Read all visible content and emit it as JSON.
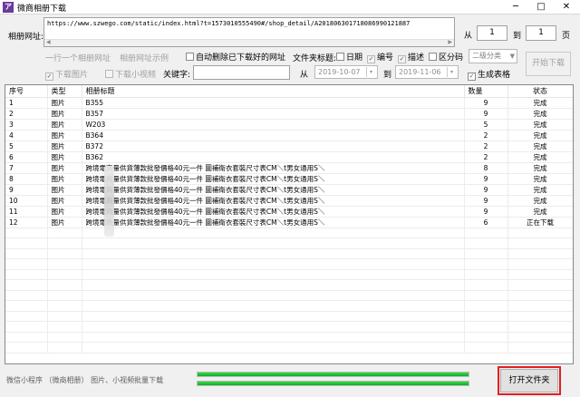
{
  "window": {
    "title": "微商相册下载",
    "icon_letter": "ア",
    "min": "─",
    "max": "□",
    "close": "✕"
  },
  "form": {
    "url_label": "相册网址:",
    "url_value": "https://www.szwego.com/static/index.html?t=1573010555490#/shop_detail/A201806301718086990121887",
    "from_label": "从",
    "from_value": "1",
    "to_label": "到",
    "to_value": "1",
    "page_label": "页",
    "one_per_line": "一行一个相册网址",
    "url_example": "相册网址示例",
    "auto_delete": "自动删除已下载好的网址",
    "folder_title_label": "文件夹标题:",
    "opt_date": "日期",
    "opt_number": "编号",
    "opt_desc": "描述",
    "opt_split": "区分码",
    "category_combo": "二级分类",
    "start_button": "开始下载",
    "download_images": "下载图片",
    "download_videos": "下载小视频",
    "keyword_label": "关键字:",
    "date_from_label": "从",
    "date_from": "2019-10-07",
    "date_to_label": "到",
    "date_to": "2019-11-06",
    "generate_table": "生成表格"
  },
  "table": {
    "columns": [
      "序号",
      "类型",
      "相册标题",
      "数量",
      "状态"
    ],
    "rows": [
      {
        "no": "1",
        "type": "图片",
        "title": "B355",
        "count": "9",
        "status": "完成"
      },
      {
        "no": "2",
        "type": "图片",
        "title": "B357",
        "count": "9",
        "status": "完成"
      },
      {
        "no": "3",
        "type": "图片",
        "title": "W203",
        "count": "5",
        "status": "完成"
      },
      {
        "no": "4",
        "type": "图片",
        "title": "B364",
        "count": "2",
        "status": "完成"
      },
      {
        "no": "5",
        "type": "图片",
        "title": "B372",
        "count": "2",
        "status": "完成"
      },
      {
        "no": "6",
        "type": "图片",
        "title": "B362",
        "count": "2",
        "status": "完成"
      },
      {
        "no": "7",
        "type": "图片",
        "title": "跨境電商量供貨薄款批發價格40元一件 圖補衛衣套裝尺寸表CM＼t男女通用S＼",
        "count": "8",
        "status": "完成"
      },
      {
        "no": "8",
        "type": "图片",
        "title": "跨境電商量供貨薄款批發價格40元一件 圖補衛衣套裝尺寸表CM＼t男女通用S＼",
        "count": "9",
        "status": "完成"
      },
      {
        "no": "9",
        "type": "图片",
        "title": "跨境電商量供貨薄款批發價格40元一件 圖補衛衣套裝尺寸表CM＼t男女通用S＼",
        "count": "9",
        "status": "完成"
      },
      {
        "no": "10",
        "type": "图片",
        "title": "跨境電商量供貨薄款批發價格40元一件 圖補衛衣套裝尺寸表CM＼t男女通用S＼",
        "count": "9",
        "status": "完成"
      },
      {
        "no": "11",
        "type": "图片",
        "title": "跨境電商量供貨薄款批發價格40元一件 圖補衛衣套裝尺寸表CM＼t男女通用S＼",
        "count": "9",
        "status": "完成"
      },
      {
        "no": "12",
        "type": "图片",
        "title": "跨境電商量供貨薄款批發價格40元一件 圖補衛衣套裝尺寸表CM＼t男女通用S＼",
        "count": "6",
        "status": "正在下载"
      }
    ]
  },
  "footer": {
    "text": "微信小程序 （微商相册） 图片、小视频批量下载",
    "progress1": 1.0,
    "progress2": 1.0,
    "open_folder": "打开文件夹"
  },
  "colors": {
    "highlight": "#e02020",
    "progress": "#06b025"
  }
}
